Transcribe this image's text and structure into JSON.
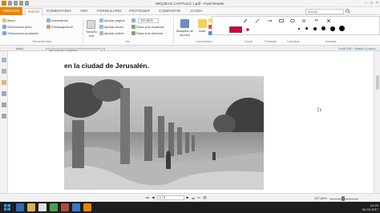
{
  "window": {
    "title": "MIQUEAS CAPITULO 1.pdf - Foxit Reader",
    "min": "–",
    "max": "□",
    "close": "×"
  },
  "ribbon": {
    "tabs": [
      "ARCHIVO",
      "INICIO",
      "COMENTARIO",
      "VER",
      "FORMULARIO",
      "PROTEGER",
      "COMPARTIR",
      "AYUDA"
    ],
    "active_tab": "INICIO",
    "search_placeholder": "Buscar",
    "groups": {
      "tools": {
        "label": "Herramientas",
        "items": [
          "Mano",
          "Seleccionar texto",
          "Seleccionar anotación"
        ]
      },
      "clipboard": {
        "items": [
          "Instantánea",
          "Portapapeles ▾"
        ]
      },
      "view": {
        "label": "Ver",
        "big_button": "Tamaño real",
        "items": [
          "Ajustar página",
          "Ajustar ancho",
          "Ajustar visible"
        ],
        "zoom_value": "157.60%"
      },
      "rotate": {
        "items": [
          "Rotar a la izquierda",
          "Rotar a la derecha"
        ]
      },
      "comment": {
        "label": "Comentario",
        "typewriter": "Máquina de escribir",
        "note": "Nota"
      },
      "markup": {
        "items": [
          "Resaltar",
          "Tachado",
          "Subrayar"
        ]
      },
      "create": {
        "label": "Crear"
      },
      "protect": {
        "label": "Proteger"
      },
      "links": {
        "label": "Vínculos"
      },
      "insert": {
        "label": "Insertar"
      }
    }
  },
  "nav": {
    "start_tab": "Inicio",
    "doc_tab": "MIQUEAS CAPITUL...",
    "foxit_link": "Foxit PDF: Search & Anno..."
  },
  "paint_toolbar": {
    "selected_color": "#d8003a",
    "tools": [
      "pencil-icon",
      "line-icon",
      "arrow-icon",
      "rectangle-icon",
      "ellipse-icon",
      "eraser-icon",
      "undo-icon",
      "close-icon"
    ]
  },
  "document": {
    "heading": "en la ciudad de Jerusalén."
  },
  "statusbar": {
    "page": "4 / 5",
    "zoom": "157.60%"
  },
  "taskbar": {
    "time": "21:29",
    "date": "30-03-2017"
  },
  "colors": {
    "accent": "#e88400",
    "active_tab_text": "#c06000",
    "taskbar_bg": "#1e1e1e"
  }
}
